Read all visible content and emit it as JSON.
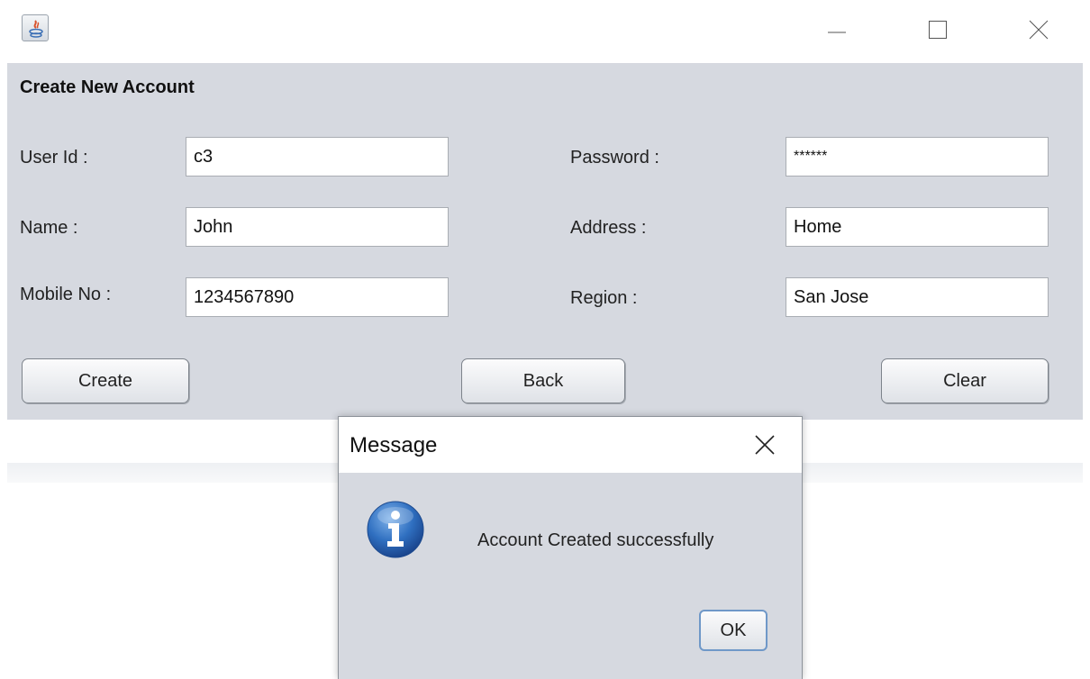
{
  "window": {
    "minimize_icon": "minimize-icon",
    "maximize_icon": "maximize-icon",
    "close_icon": "close-icon"
  },
  "form": {
    "heading": "Create New Account",
    "labels": {
      "user_id": "User Id :",
      "password": "Password :",
      "name": "Name :",
      "address": "Address :",
      "mobile": "Mobile No :",
      "region": "Region :"
    },
    "values": {
      "user_id": "c3",
      "password": "******",
      "name": "John",
      "address": "Home",
      "mobile": "1234567890",
      "region": "San Jose"
    },
    "buttons": {
      "create": "Create",
      "back": "Back",
      "clear": "Clear"
    }
  },
  "dialog": {
    "title": "Message",
    "message": "Account Created successfully",
    "ok": "OK",
    "icon": "info-icon"
  },
  "colors": {
    "panel": "#d6d9e0",
    "info_blue": "#2f6fc0"
  }
}
